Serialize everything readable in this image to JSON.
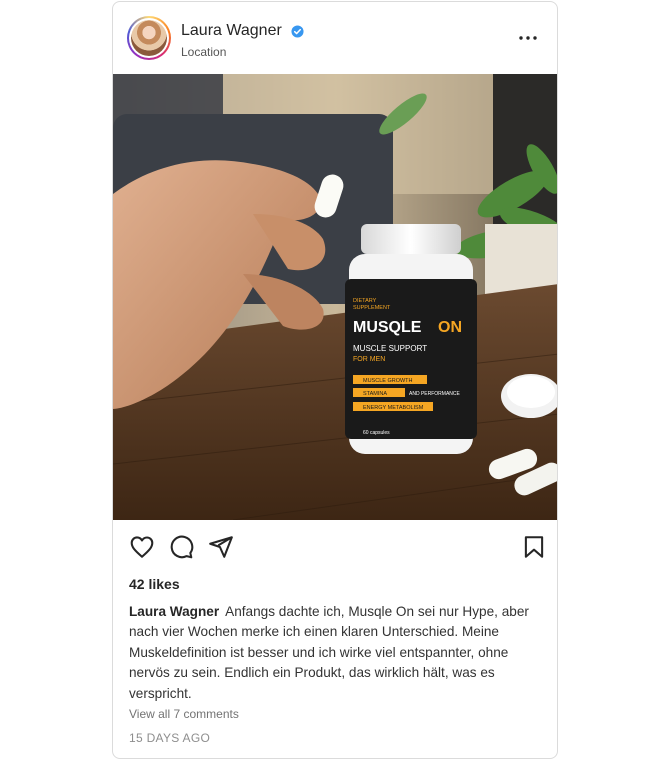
{
  "post": {
    "user_name": "Laura Wagner",
    "location": "Location",
    "likes": "42 likes",
    "caption_author": "Laura Wagner",
    "caption_text": "Anfangs dachte ich, Musqle On sei nur Hype, aber nach vier Wochen merke ich einen klaren Unterschied. Meine Muskeldefinition ist besser und ich wirke viel entspannter, ohne nervös zu sein. Endlich ein Produkt, das wirklich hält, was es verspricht.",
    "view_comments": "View all 7 comments",
    "timestamp": "15 DAYS AGO"
  },
  "product": {
    "label_top_1": "DIETARY",
    "label_top_2": "SUPPLEMENT",
    "brand_a": "MUSQLE",
    "brand_b": "ON",
    "tagline_1": "MUSCLE SUPPORT",
    "tagline_2": "FOR MEN",
    "feature_1": "MUSCLE GROWTH",
    "feature_2": "STAMINA",
    "feature_2_extra": "AND PERFORMANCE",
    "feature_3": "ENERGY METABOLISM",
    "count": "60 capsules"
  },
  "colors": {
    "verified": "#3897f0",
    "accent_orange": "#f5a623"
  },
  "icons": {
    "like": "heart-icon",
    "comment": "comment-icon",
    "share": "send-icon",
    "save": "bookmark-icon",
    "more": "more-horizontal-icon"
  }
}
